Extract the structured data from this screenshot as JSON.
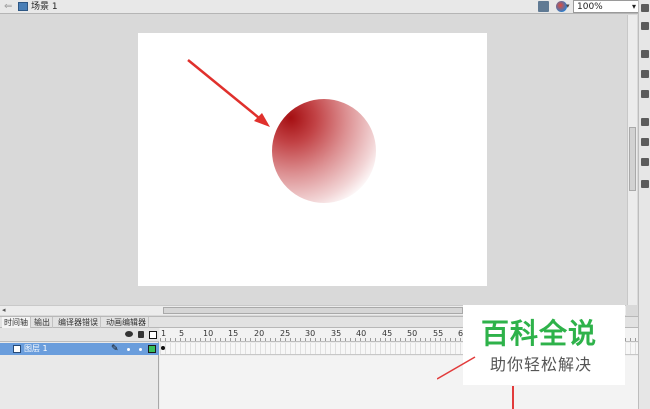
{
  "topbar": {
    "scene_label": "场景 1",
    "zoom_value": "100%"
  },
  "tabs": [
    "时间轴",
    "输出",
    "编译器错误",
    "动画编辑器"
  ],
  "timeline": {
    "layer_name": "图层 1",
    "frame_numbers": [
      "1",
      "5",
      "10",
      "15",
      "20",
      "25",
      "30",
      "35",
      "40",
      "45",
      "50",
      "55",
      "6"
    ]
  },
  "stage": {
    "background": "#ffffff",
    "circle_colors": {
      "center": "#a50f12",
      "edge": "#ffffff"
    },
    "arrow_color": "#e0302c"
  },
  "watermark": {
    "title": "百科全说",
    "subtitle": "助你轻松解决",
    "title_color": "#2eb24a"
  }
}
